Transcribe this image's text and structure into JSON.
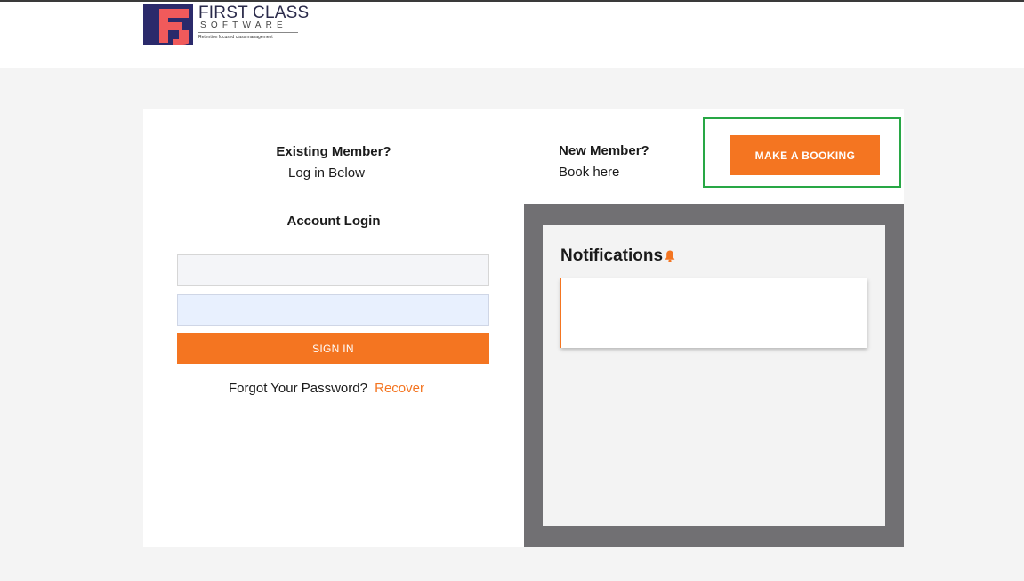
{
  "header": {
    "logo": {
      "title": "FIRST CLASS",
      "subtitle": "SOFTWARE",
      "tagline": "Retention focused class management"
    }
  },
  "login": {
    "existing_title": "Existing Member?",
    "existing_sub": "Log in Below",
    "account_title": "Account Login",
    "username_value": "",
    "password_value": "",
    "signin_label": "SIGN IN",
    "forgot_text": "Forgot Your Password?",
    "recover_label": "Recover"
  },
  "new_member": {
    "title": "New Member?",
    "sub": "Book here",
    "booking_label": "MAKE A BOOKING"
  },
  "notifications": {
    "title": "Notifications",
    "icon": "bell-icon"
  },
  "colors": {
    "accent": "#f47521",
    "panel": "#717073",
    "highlight": "#28a745"
  }
}
